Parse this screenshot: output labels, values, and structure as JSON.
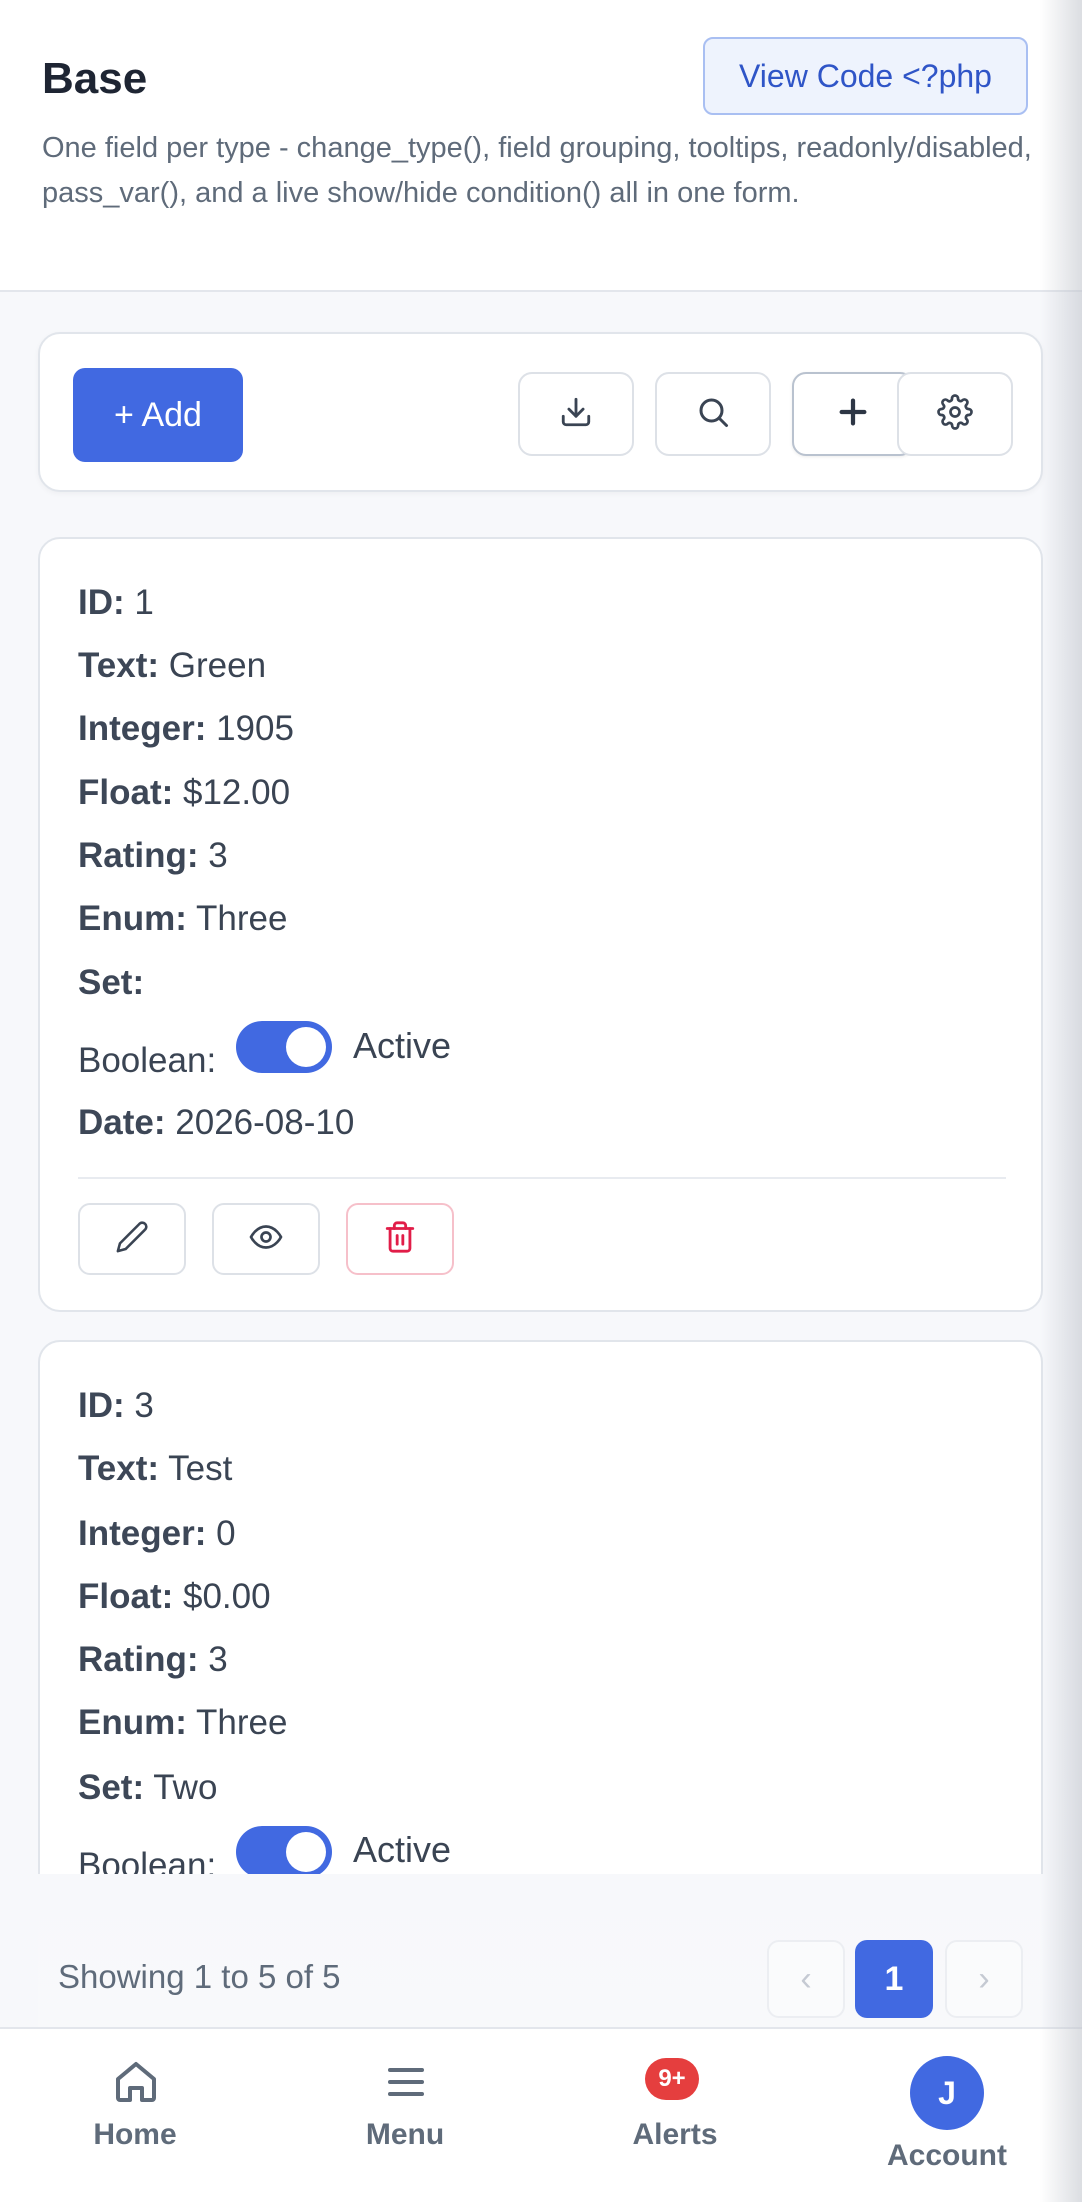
{
  "header": {
    "title": "Base",
    "view_code_label": "View Code <?php",
    "description": "One field per type - change_type(), field grouping, tooltips, readonly/disabled, pass_var(), and a live show/hide condition() all in one form."
  },
  "toolbar": {
    "add_label": "+ Add",
    "icons": [
      "download-icon",
      "search-icon",
      "plus-icon",
      "gear-icon"
    ]
  },
  "records": [
    {
      "id_label": "ID:",
      "id": "1",
      "text_label": "Text:",
      "text": "Green",
      "integer_label": "Integer:",
      "integer": "1905",
      "float_label": "Float:",
      "float": "$12.00",
      "rating_label": "Rating:",
      "rating": "3",
      "enum_label": "Enum:",
      "enum": "Three",
      "set_label": "Set:",
      "set": "",
      "boolean_label": "Boolean:",
      "boolean": "Active",
      "date_label": "Date:",
      "date": "2026-08-10"
    },
    {
      "id_label": "ID:",
      "id": "3",
      "text_label": "Text:",
      "text": "Test",
      "integer_label": "Integer:",
      "integer": "0",
      "float_label": "Float:",
      "float": "$0.00",
      "rating_label": "Rating:",
      "rating": "3",
      "enum_label": "Enum:",
      "enum": "Three",
      "set_label": "Set:",
      "set": "Two",
      "boolean_label": "Boolean:",
      "boolean": "Active"
    }
  ],
  "pagination": {
    "summary": "Showing 1 to 5 of 5",
    "prev": "‹",
    "current": "1",
    "next": "›"
  },
  "bottom_nav": {
    "home": "Home",
    "menu": "Menu",
    "alerts": "Alerts",
    "alerts_badge": "9+",
    "account": "Account",
    "avatar_initial": "J"
  },
  "colors": {
    "accent": "#4169e1",
    "danger": "#e11d48",
    "badge": "#e53e3e"
  }
}
